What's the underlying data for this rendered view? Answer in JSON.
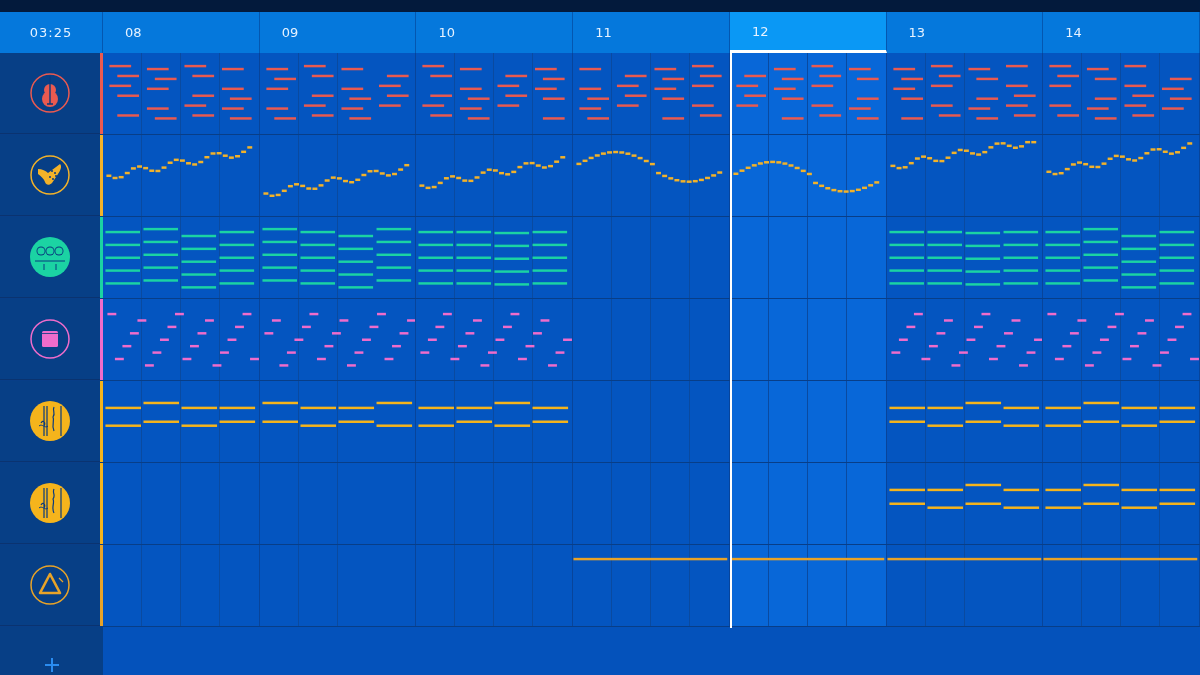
{
  "header": {
    "time": "03:25",
    "bars": [
      {
        "label": "08",
        "selected": false
      },
      {
        "label": "09",
        "selected": false
      },
      {
        "label": "10",
        "selected": false
      },
      {
        "label": "11",
        "selected": false
      },
      {
        "label": "12",
        "selected": true
      },
      {
        "label": "13",
        "selected": false
      },
      {
        "label": "14",
        "selected": false
      }
    ]
  },
  "tracks": [
    {
      "kind": "guitar",
      "color": "#ea5a50",
      "filled": [
        true,
        true,
        true,
        true,
        true,
        true,
        true
      ]
    },
    {
      "kind": "ocarina",
      "color": "#f2b22a",
      "filled": [
        true,
        true,
        true,
        true,
        true,
        true,
        true
      ]
    },
    {
      "kind": "choir",
      "color": "#1bd3a3",
      "filled": [
        true,
        true,
        true,
        false,
        false,
        true,
        true
      ]
    },
    {
      "kind": "square",
      "color": "#f06ccb",
      "filled": [
        true,
        true,
        true,
        false,
        false,
        true,
        true
      ]
    },
    {
      "kind": "strings",
      "color": "#f5b41c",
      "filled": [
        true,
        true,
        true,
        false,
        false,
        true,
        true
      ]
    },
    {
      "kind": "strings",
      "color": "#f5b41c",
      "filled": [
        false,
        false,
        false,
        false,
        false,
        true,
        true
      ]
    },
    {
      "kind": "triangle",
      "color": "#e8a328",
      "filled": [
        false,
        false,
        false,
        true,
        true,
        true,
        true
      ]
    }
  ]
}
